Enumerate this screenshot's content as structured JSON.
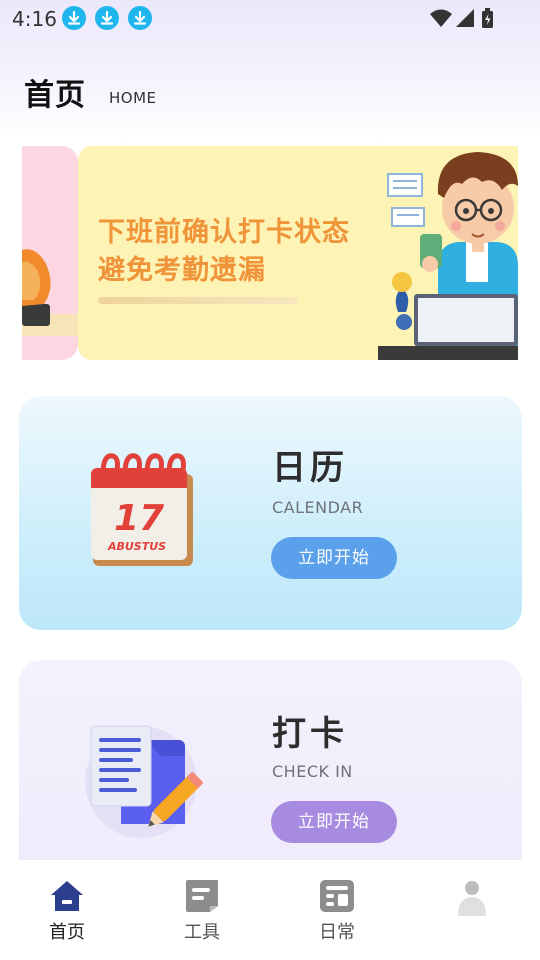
{
  "status_bar": {
    "time": "4:16",
    "notification_icons": [
      "download-icon",
      "download-icon",
      "download-icon"
    ],
    "system_icons": [
      "wifi-icon",
      "signal-icon",
      "battery-charging-icon"
    ]
  },
  "header": {
    "title": "首页",
    "subtitle": "HOME"
  },
  "banner": {
    "line1": "下班前确认打卡状态",
    "line2": "避免考勤遗漏",
    "calendar_date": "17",
    "calendar_month": "ABUSTUS"
  },
  "cards": {
    "calendar": {
      "title": "日历",
      "subtitle": "CALENDAR",
      "button": "立即开始",
      "icon": "calendar-icon",
      "button_color": "#5aa0ea"
    },
    "checkin": {
      "title": "打卡",
      "subtitle": "CHECK IN",
      "button": "立即开始",
      "icon": "document-edit-icon",
      "button_color": "#a68be0"
    }
  },
  "bottom_nav": {
    "items": [
      {
        "label": "首页",
        "icon": "home-icon",
        "active": true
      },
      {
        "label": "工具",
        "icon": "tools-icon",
        "active": false
      },
      {
        "label": "日常",
        "icon": "daily-icon",
        "active": false
      },
      {
        "label": "",
        "icon": "profile-icon",
        "active": false
      }
    ],
    "active_color": "#2c3f8c"
  }
}
